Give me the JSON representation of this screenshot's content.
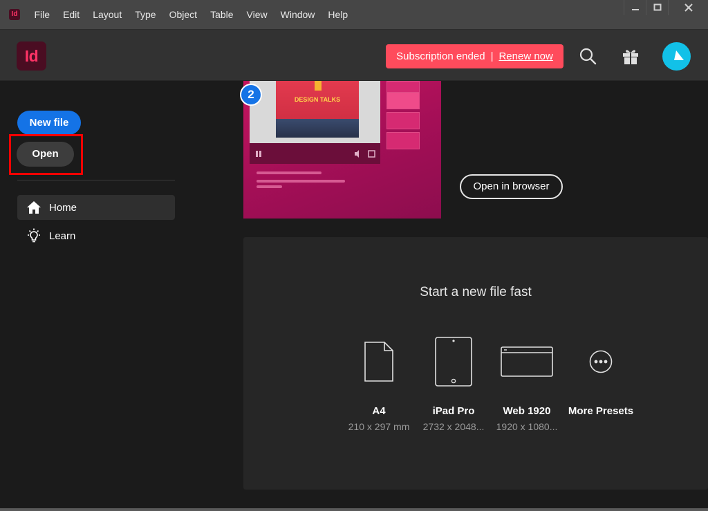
{
  "menu": {
    "app_icon_text": "Id",
    "items": [
      "File",
      "Edit",
      "Layout",
      "Type",
      "Object",
      "Table",
      "View",
      "Window",
      "Help"
    ]
  },
  "header": {
    "logo_text": "Id",
    "subscription_text": "Subscription ended",
    "separator": "|",
    "renew_text": "Renew now",
    "icons": [
      "search-icon",
      "gift-icon",
      "avatar"
    ]
  },
  "sidebar": {
    "new_file": "New file",
    "open": "Open",
    "nav": [
      {
        "label": "Home",
        "icon": "home-icon",
        "active": true
      },
      {
        "label": "Learn",
        "icon": "lightbulb-icon",
        "active": false
      }
    ]
  },
  "hero": {
    "badge": "2",
    "poster_title": "DESIGN TALKS",
    "open_in_browser": "Open in browser"
  },
  "presets": {
    "title": "Start a new file fast",
    "items": [
      {
        "name": "A4",
        "dims": "210 x 297 mm",
        "icon": "page-icon"
      },
      {
        "name": "iPad Pro",
        "dims": "2732 x 2048...",
        "icon": "tablet-icon"
      },
      {
        "name": "Web 1920",
        "dims": "1920 x 1080...",
        "icon": "browser-icon"
      },
      {
        "name": "More Presets",
        "dims": "",
        "icon": "more-icon"
      }
    ]
  },
  "colors": {
    "accent": "#1473e6",
    "brand": "#ff3366",
    "banner": "#ff4b5c",
    "highlight": "#ff0000"
  }
}
